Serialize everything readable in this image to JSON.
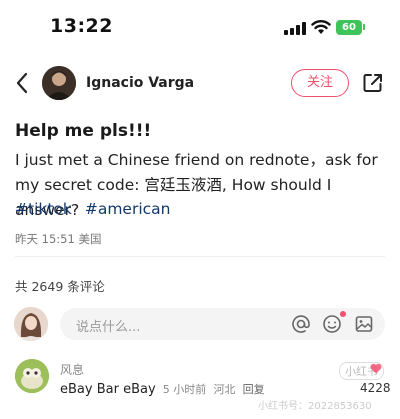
{
  "status_bar": {
    "time": "13:22",
    "battery_label": "60",
    "battery_color": "#3fc45a"
  },
  "header": {
    "author_name": "Ignacio Varga",
    "follow_label": "关注",
    "accent_color": "#f0506e",
    "icons": [
      "chevron-left-icon",
      "share-icon"
    ]
  },
  "note": {
    "title": "Help me pls!!!",
    "body": "I just met a Chinese friend on rednote，ask for my secret code: 宫廷玉液酒, How should I answer?",
    "tags": [
      "#tiktok",
      "#american"
    ],
    "meta": "昨天 15:51 美国"
  },
  "comments": {
    "count_label": "共 2649 条评论",
    "input_placeholder": "说点什么...",
    "composer_icons": [
      "at-icon",
      "emoji-icon",
      "image-icon"
    ],
    "items": [
      {
        "author": "风息",
        "text": "eBay Bar eBay",
        "time": "5 小时前",
        "location": "河北",
        "reply_label": "回复",
        "likes": "4228"
      }
    ]
  },
  "watermark": {
    "badge": "小红书",
    "id_text": "小红书号：2022853630"
  }
}
